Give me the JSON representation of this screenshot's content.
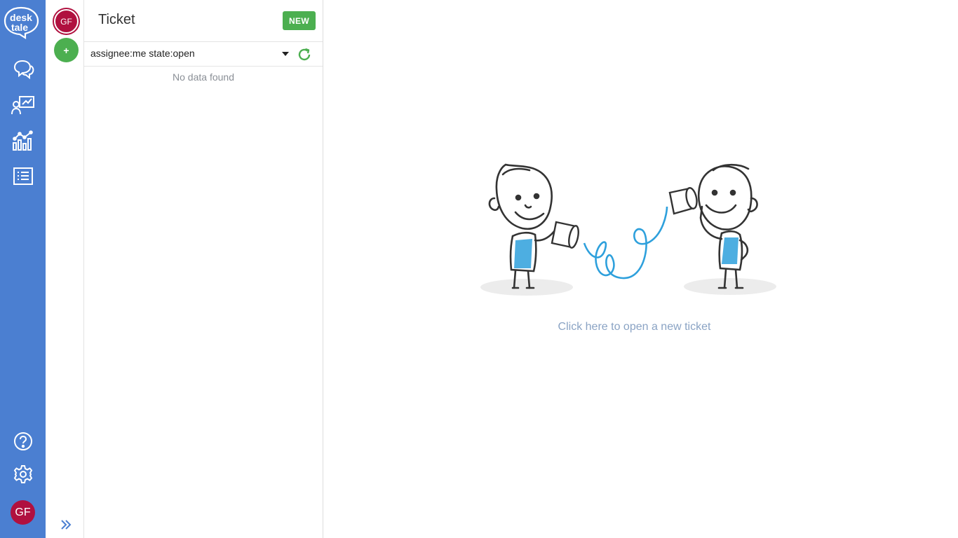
{
  "app": {
    "logo_line1": "desk",
    "logo_line2": "tale"
  },
  "rail": {
    "items": [
      {
        "icon": "chat-icon"
      },
      {
        "icon": "presentation-icon"
      },
      {
        "icon": "analytics-icon"
      },
      {
        "icon": "list-icon"
      }
    ],
    "help_icon": "help-icon",
    "settings_icon": "gear-icon",
    "user_initials": "GF"
  },
  "agents": {
    "current_initials": "GF",
    "add_label": "+",
    "expand_icon": "double-chevron-right-icon"
  },
  "ticket_panel": {
    "title": "Ticket",
    "new_button_label": "NEW",
    "filter_value": "assignee:me state:open",
    "empty_text": "No data found"
  },
  "main": {
    "cta_text": "Click here to open a new ticket"
  },
  "colors": {
    "rail": "#4b7fd1",
    "accent_green": "#4caf50",
    "avatar": "#b0103f",
    "cta_text": "#8aa3c4"
  }
}
